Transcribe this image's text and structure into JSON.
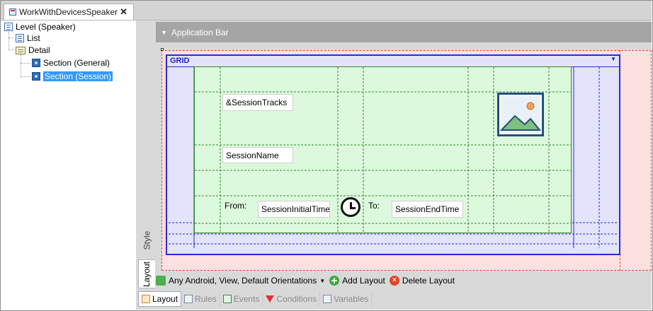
{
  "tab": {
    "title": "WorkWithDevicesSpeaker",
    "close": "✕"
  },
  "tree": {
    "items": [
      {
        "label": "Level (Speaker)"
      },
      {
        "label": "List"
      },
      {
        "label": "Detail"
      },
      {
        "label": "Section (General)"
      },
      {
        "label": "Section (Session)",
        "selected": true
      }
    ]
  },
  "side_tabs": {
    "style": "Style",
    "layout": "Layout"
  },
  "app_bar": {
    "label": "Application Bar"
  },
  "grid": {
    "title": "GRID",
    "fields": {
      "session_tracks": "&SessionTracks",
      "session_name": "SessionName",
      "from_label": "From:",
      "session_initial_time": "SessionInitialTime",
      "to_label": "To:",
      "session_end_time": "SessionEndTime"
    }
  },
  "toolbar": {
    "layout_selector": "Any Android, View, Default Orientations",
    "add_layout": "Add Layout",
    "delete_layout": "Delete Layout"
  },
  "bottom_tabs": [
    {
      "label": "Layout",
      "active": true
    },
    {
      "label": "Rules",
      "active": false
    },
    {
      "label": "Events",
      "active": false
    },
    {
      "label": "Conditions",
      "active": false
    },
    {
      "label": "Variables",
      "active": false
    }
  ],
  "colors": {
    "selection": "#3399ff",
    "grid_border": "#2b2bd6",
    "table_fill": "#ddf9dd",
    "canvas_fill": "#fde0e0"
  }
}
